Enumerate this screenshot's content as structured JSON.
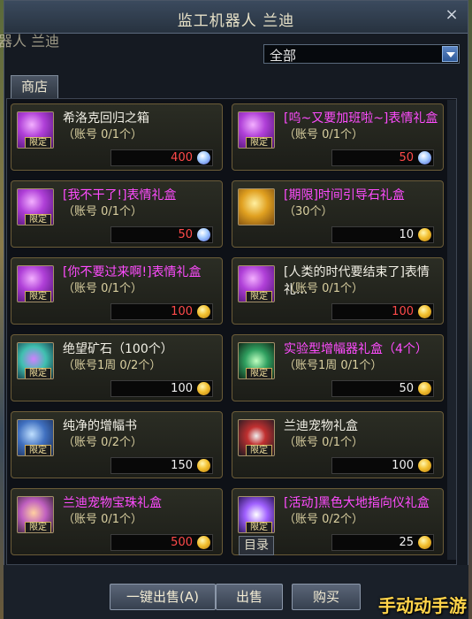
{
  "window": {
    "title": "监工机器人 兰迪",
    "close_label": "×",
    "npc_name_behind": "器人 兰迪"
  },
  "filter": {
    "selected": "全部"
  },
  "tabs": {
    "shop": "商店"
  },
  "items": [
    {
      "name": "希洛克回归之箱",
      "limit": "（账号 0/1个）",
      "price": "400",
      "price_color": "red",
      "currency": "cera-icon",
      "name_color": "white",
      "icon": "purple-chest-icon",
      "tag": "限定"
    },
    {
      "name": "[呜~又要加班啦~]表情礼盒",
      "limit": "（账号 0/1个）",
      "price": "50",
      "price_color": "red",
      "currency": "cera-icon",
      "name_color": "magenta",
      "icon": "purple-giftbox-icon",
      "tag": "限定"
    },
    {
      "name": "[我不干了!]表情礼盒",
      "limit": "（账号 0/1个）",
      "price": "50",
      "price_color": "red",
      "currency": "cera-icon",
      "name_color": "magenta",
      "icon": "purple-giftbox-icon",
      "tag": "限定"
    },
    {
      "name": "[期限]时间引导石礼盒",
      "limit": "（30个）",
      "price": "10",
      "price_color": "white",
      "currency": "gold-coin-icon",
      "name_color": "magenta",
      "icon": "gold-box-icon",
      "tag": ""
    },
    {
      "name": "[你不要过来啊!]表情礼盒",
      "limit": "（账号 0/1个）",
      "price": "100",
      "price_color": "red",
      "currency": "gold-coin-icon",
      "name_color": "magenta",
      "icon": "purple-giftbox-icon",
      "tag": "限定"
    },
    {
      "name": "[人类的时代要结束了]表情礼...",
      "limit": "（账号 0/1个）",
      "price": "100",
      "price_color": "red",
      "currency": "gold-coin-icon",
      "name_color": "white",
      "icon": "purple-giftbox-icon",
      "tag": "限定"
    },
    {
      "name": "绝望矿石（100个）",
      "limit": "（账号1周 0/2个）",
      "price": "100",
      "price_color": "white",
      "currency": "gold-coin-icon",
      "name_color": "white",
      "icon": "ore-icon",
      "tag": "限定"
    },
    {
      "name": "实验型增幅器礼盒（4个）",
      "limit": "（账号1周 0/1个）",
      "price": "50",
      "price_color": "white",
      "currency": "gold-coin-icon",
      "name_color": "magenta",
      "icon": "amplifier-icon",
      "tag": "限定"
    },
    {
      "name": "纯净的增幅书",
      "limit": "（账号 0/2个）",
      "price": "150",
      "price_color": "white",
      "currency": "gold-coin-icon",
      "name_color": "white",
      "icon": "book-icon",
      "tag": "限定"
    },
    {
      "name": "兰迪宠物礼盒",
      "limit": "（账号 0/1个）",
      "price": "100",
      "price_color": "white",
      "currency": "gold-coin-icon",
      "name_color": "white",
      "icon": "pet-box-icon",
      "tag": "限定"
    },
    {
      "name": "兰迪宠物宝珠礼盒",
      "limit": "（账号 0/1个）",
      "price": "500",
      "price_color": "red",
      "currency": "gold-coin-icon",
      "name_color": "magenta",
      "icon": "orb-box-icon",
      "tag": "限定"
    },
    {
      "name": "[活动]黑色大地指向仪礼盒",
      "limit": "（账号 0/2个）",
      "price": "25",
      "price_color": "white",
      "currency": "gold-coin-icon",
      "name_color": "magenta",
      "icon": "compass-box-icon",
      "tag": "限定"
    }
  ],
  "catalog_label": "目录",
  "buttons": {
    "sell_all": "一键出售(A)",
    "sell": "出售",
    "buy": "购买"
  },
  "watermark": "手动动手游",
  "colors": {
    "name_white": "#f2f0e6",
    "name_magenta": "#ff4cff",
    "price_red": "#ff4a4a",
    "accent_gold": "#caa95a"
  }
}
